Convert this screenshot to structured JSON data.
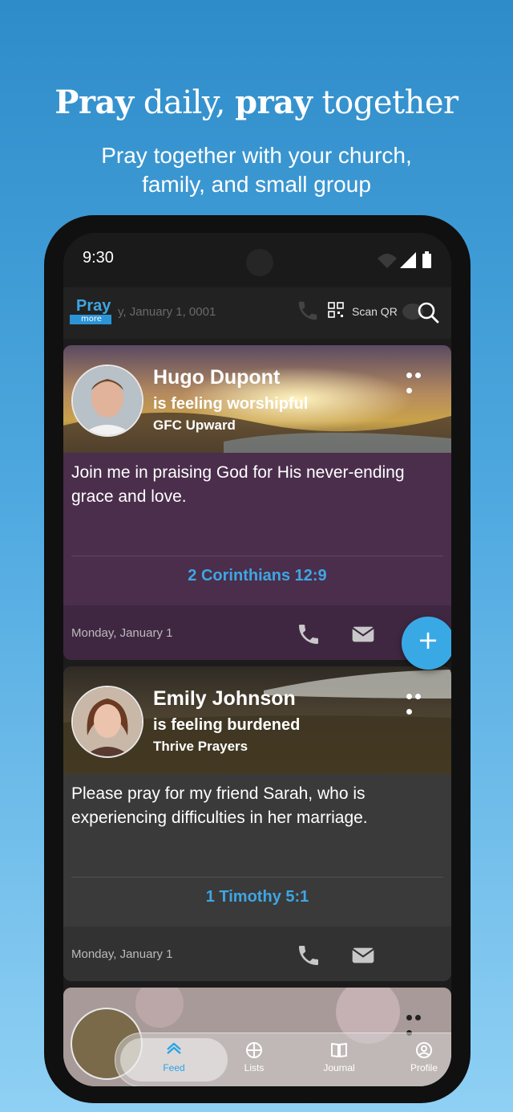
{
  "promo": {
    "headline_1": "Pray",
    "headline_2": " daily, ",
    "headline_3": "pray",
    "headline_4": " together",
    "subhead_1": "Pray together with your church,",
    "subhead_2": "family, and small group"
  },
  "status": {
    "time": "9:30"
  },
  "appbar": {
    "logo_pray": "Pray",
    "logo_more": "more",
    "date": "y, January 1, 0001",
    "scan_qr": "Scan QR"
  },
  "posts": [
    {
      "name": "Hugo Dupont",
      "feeling": "is feeling worshipful",
      "group": "GFC Upward",
      "text": "Join me in praising God for His never-ending grace and love.",
      "verse": "2 Corinthians 12:9",
      "date": "Monday, January 1"
    },
    {
      "name": "Emily Johnson",
      "feeling": "is feeling burdened",
      "group": "Thrive Prayers",
      "text": "Please pray for my friend Sarah, who is experiencing difficulties in her marriage.",
      "verse": "1 Timothy 5:1",
      "date": "Monday, January 1"
    }
  ],
  "fab": {
    "label": "+"
  },
  "nav": [
    {
      "label": "Feed",
      "icon": "home-icon",
      "active": true
    },
    {
      "label": "Lists",
      "icon": "globe-icon"
    },
    {
      "label": "Journal",
      "icon": "book-icon"
    },
    {
      "label": "Profile",
      "icon": "profile-icon"
    }
  ],
  "colors": {
    "accent": "#3ea6e3",
    "card1_bg": "#4a2e4c",
    "card2_bg": "#3a3a3a"
  }
}
